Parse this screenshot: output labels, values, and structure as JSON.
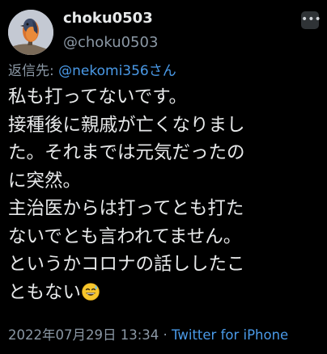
{
  "user": {
    "display_name": "choku0503",
    "handle": "@choku0503"
  },
  "reply": {
    "prefix": "返信先: ",
    "mention": "@nekomi356さん"
  },
  "tweet": {
    "lines": [
      "私も打ってないです。",
      "接種後に親戚が亡くなりまし",
      "た。それまでは元気だったの",
      "に突然。",
      "主治医からは打ってとも打た",
      "ないでとも言われてません。",
      "というかコロナの話ししたこ",
      "ともない"
    ]
  },
  "meta": {
    "timestamp": "2022年07月29日 13:34",
    "separator": " · ",
    "source": "Twitter for iPhone"
  },
  "icons": {
    "more": "ellipsis-icon",
    "emoji": "grinning-sweat-emoji"
  },
  "colors": {
    "background": "#000000",
    "text": "#e7e9ea",
    "secondary": "#8b98a5",
    "link": "#4a9ae8"
  }
}
